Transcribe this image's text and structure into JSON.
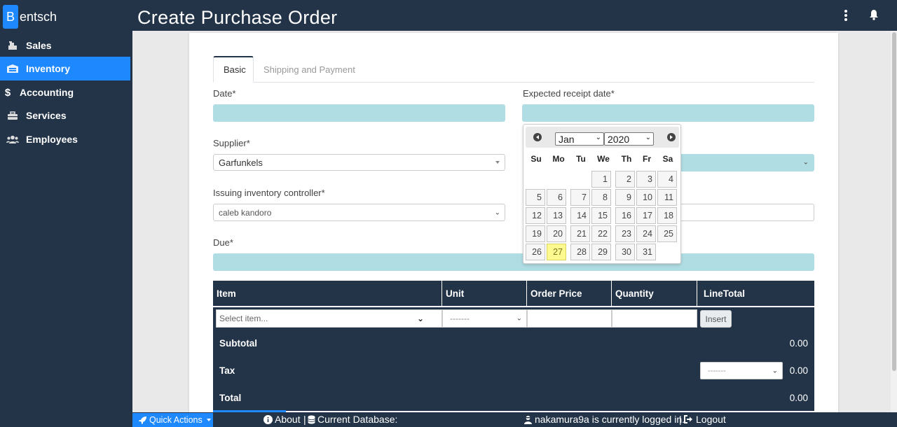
{
  "brand": {
    "initial": "B",
    "rest": "entsch"
  },
  "page_title": "Create Purchase Order",
  "sidebar": {
    "items": [
      {
        "label": "Sales",
        "icon": "cash-register-icon",
        "active": false
      },
      {
        "label": "Inventory",
        "icon": "warehouse-icon",
        "active": true
      },
      {
        "label": "Accounting",
        "icon": "dollar-icon",
        "active": false
      },
      {
        "label": "Services",
        "icon": "toolbox-icon",
        "active": false
      },
      {
        "label": "Employees",
        "icon": "users-icon",
        "active": false
      }
    ]
  },
  "tabs": [
    {
      "label": "Basic",
      "active": true
    },
    {
      "label": "Shipping and Payment",
      "active": false
    }
  ],
  "form": {
    "date_label": "Date*",
    "expected_receipt_label": "Expected receipt date*",
    "supplier_label": "Supplier*",
    "supplier_value": "Garfunkels",
    "issuing_label": "Issuing inventory controller*",
    "issuing_value": "caleb kandoro",
    "due_label": "Due*"
  },
  "table": {
    "headers": [
      "Item",
      "Unit",
      "Order Price",
      "Quantity",
      "LineTotal"
    ],
    "item_placeholder": "Select item...",
    "unit_placeholder": "-------",
    "insert_label": "Insert",
    "subtotal_label": "Subtotal",
    "subtotal_value": "0.00",
    "tax_label": "Tax",
    "tax_placeholder": "-------",
    "tax_value": "0.00",
    "total_label": "Total",
    "total_value": "0.00"
  },
  "datepicker": {
    "month": "Jan",
    "year": "2020",
    "weekdays": [
      "Su",
      "Mo",
      "Tu",
      "We",
      "Th",
      "Fr",
      "Sa"
    ],
    "days": [
      "1",
      "2",
      "3",
      "4",
      "5",
      "6",
      "7",
      "8",
      "9",
      "10",
      "11",
      "12",
      "13",
      "14",
      "15",
      "16",
      "17",
      "18",
      "19",
      "20",
      "21",
      "22",
      "23",
      "24",
      "25",
      "26",
      "27",
      "28",
      "29",
      "30",
      "31"
    ],
    "today": "27"
  },
  "footer": {
    "quick_actions": "Quick Actions",
    "about": "About",
    "current_db": "Current Database:",
    "logged_in": "nakamura9a is currently logged in.",
    "logout": "Logout"
  },
  "colors": {
    "navy": "#233448",
    "accent": "#1e88ff",
    "field": "#b0dde4",
    "today": "#fffa90"
  }
}
